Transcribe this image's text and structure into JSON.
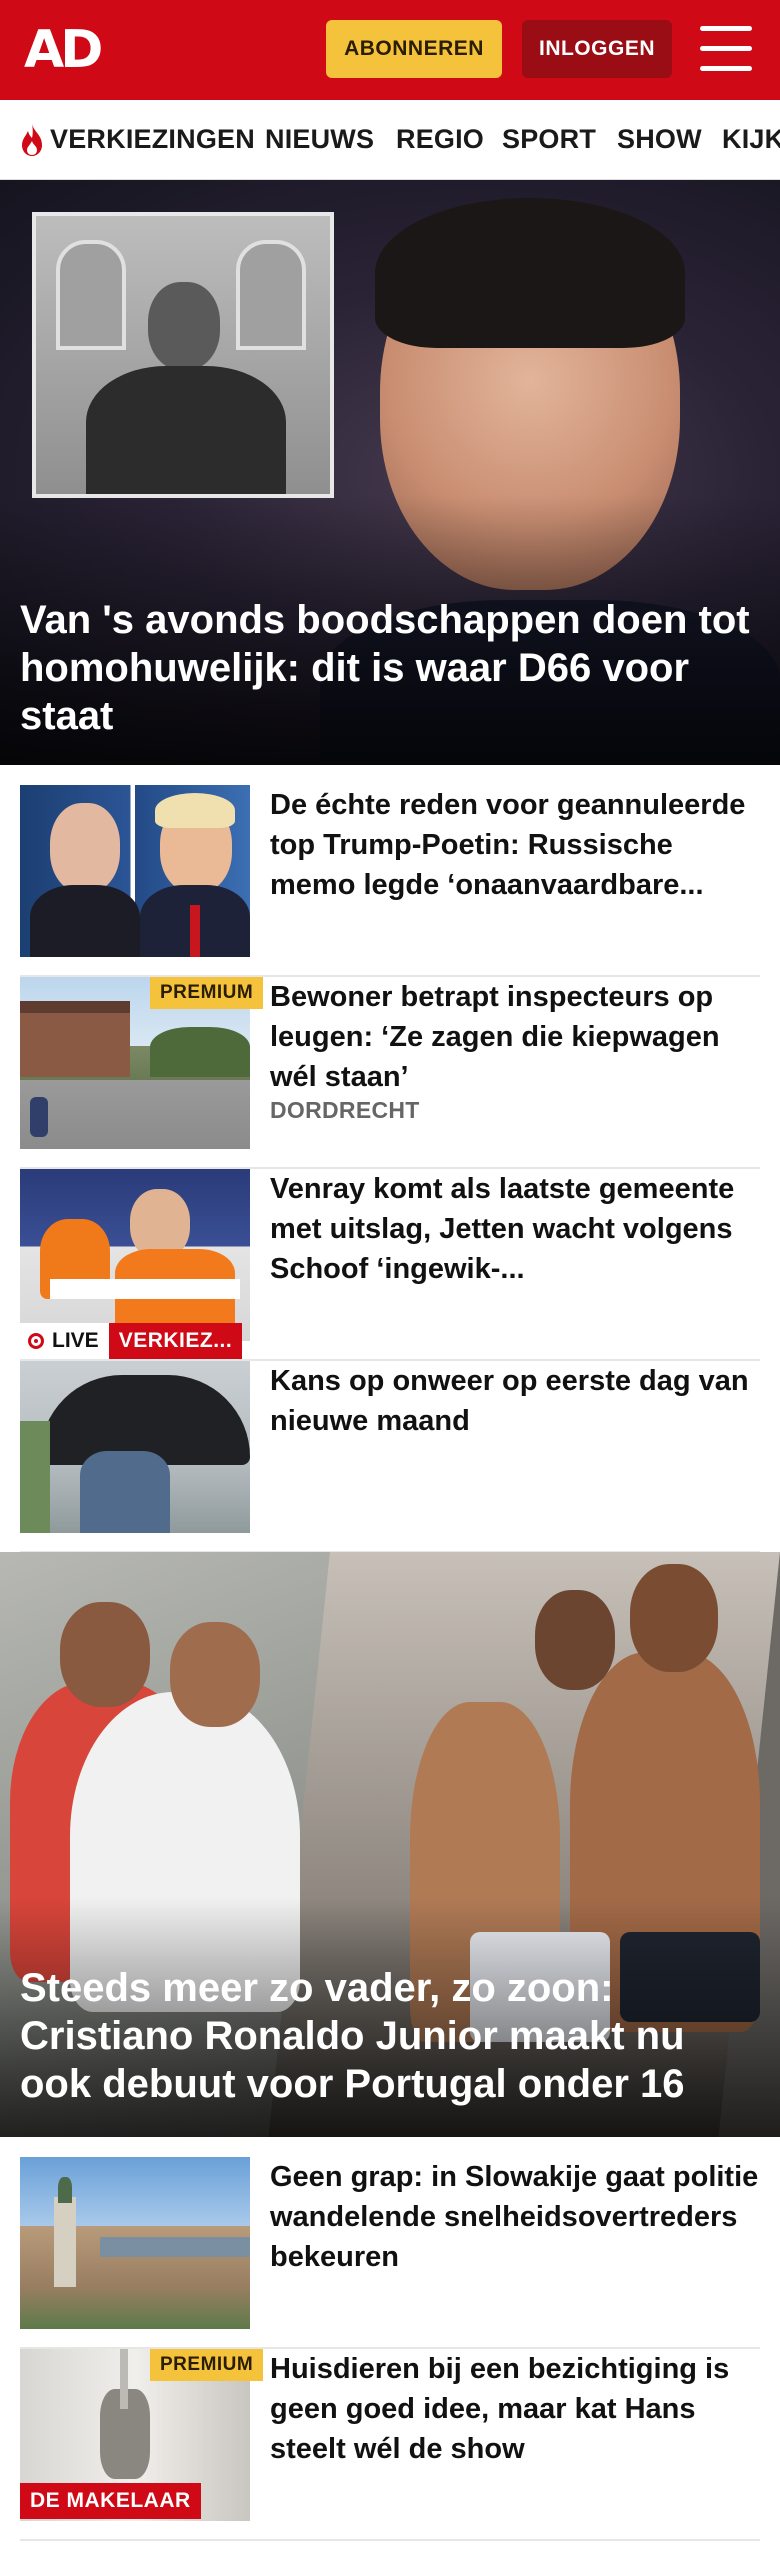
{
  "header": {
    "logo": "AD",
    "subscribe_label": "ABONNEREN",
    "login_label": "INLOGGEN",
    "brand_color": "#cf0a16",
    "accent_color": "#f5c33b"
  },
  "nav": {
    "items": [
      {
        "label": "VERKIEZINGEN",
        "icon": "flame-icon"
      },
      {
        "label": "NIEUWS"
      },
      {
        "label": "REGIO"
      },
      {
        "label": "SPORT"
      },
      {
        "label": "SHOW"
      },
      {
        "label": "KIJK"
      }
    ]
  },
  "hero": {
    "title": "Van 's avonds boodschappen doen tot homohuwelijk: dit is waar D66 voor staat"
  },
  "articles": [
    {
      "title": "De échte reden voor geannuleerde top Trump-Poetin: Russische memo legde ‘onaanvaardbare...",
      "tag": "",
      "premium": "",
      "live": "",
      "badge": ""
    },
    {
      "title": "Bewoner betrapt inspecteurs op leugen: ‘Ze zagen die kiepwagen wél staan’",
      "tag": "DORDRECHT",
      "premium": "PREMIUM",
      "live": "",
      "badge": ""
    },
    {
      "title": "Venray komt als laatste gemeente met uitslag, Jetten wacht volgens Schoof ‘ingewik-...",
      "tag": "",
      "premium": "",
      "live": "LIVE",
      "badge": "VERKIEZ..."
    },
    {
      "title": "Kans op onweer op eerste dag van nieuwe maand",
      "tag": "",
      "premium": "",
      "live": "",
      "badge": ""
    }
  ],
  "feature": {
    "title": "Steeds meer zo vader, zo zoon: Cristiano Ronaldo Junior maakt nu ook debuut voor Portugal onder 16"
  },
  "articles_2": [
    {
      "title": "Geen grap: in Slowakije gaat politie wandelende snelheidsovertreders bekeuren",
      "premium": "",
      "badge": ""
    },
    {
      "title": "Huisdieren bij een bezichtiging is geen goed idee, maar kat Hans steelt wél de show",
      "premium": "PREMIUM",
      "badge": "DE MAKELAAR"
    }
  ]
}
